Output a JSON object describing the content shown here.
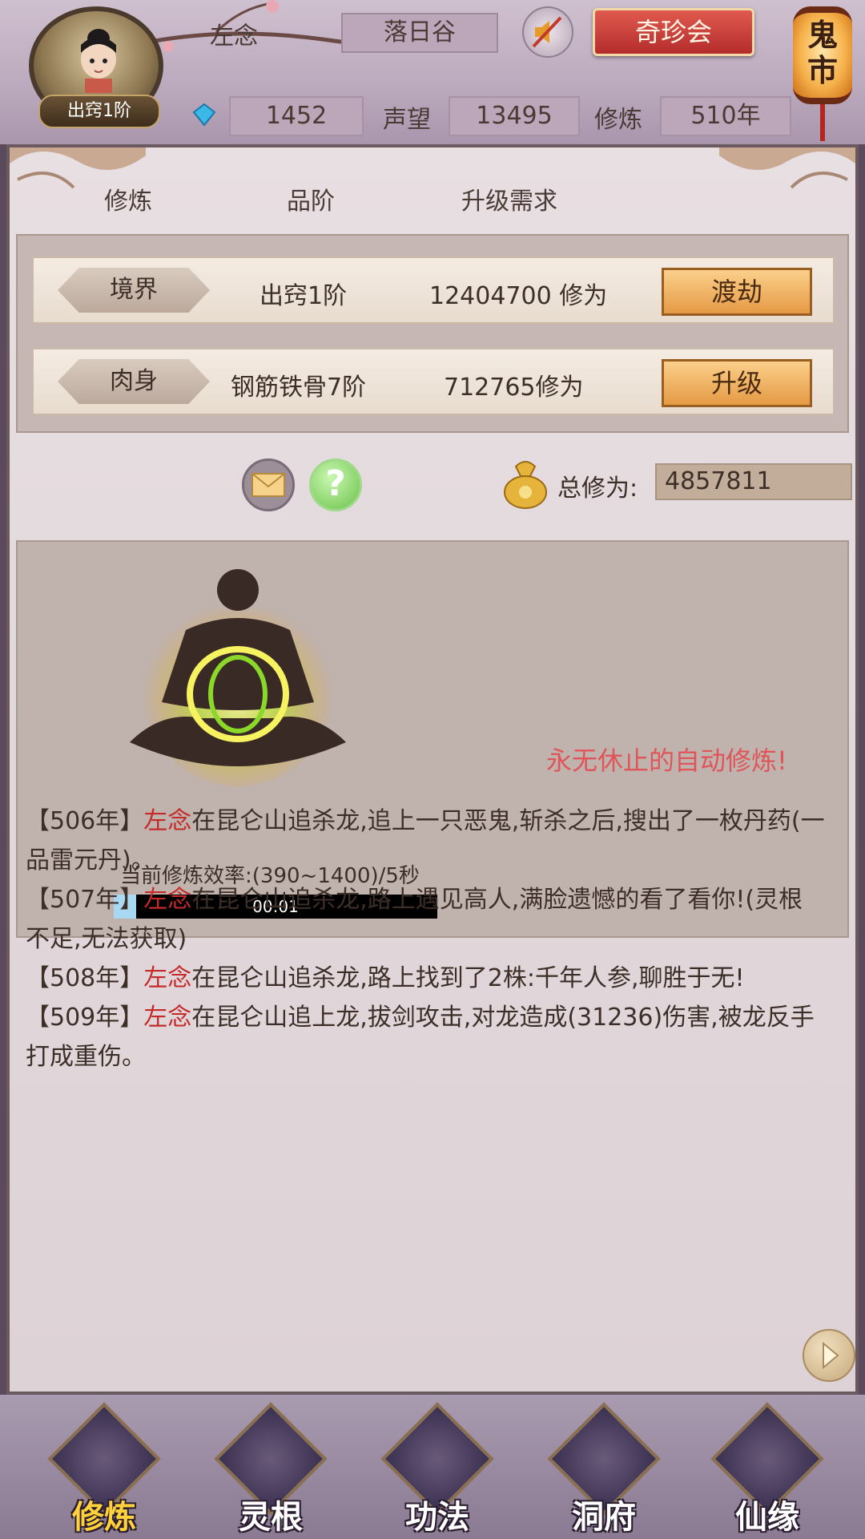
{
  "header": {
    "rank": "出窍1阶",
    "player_name": "左念",
    "location": "落日谷",
    "treasure_button": "奇珍会",
    "ghost_market": "鬼市",
    "gems": "1452",
    "prestige_label": "声望",
    "prestige": "13495",
    "cultivation_label": "修炼",
    "cultivation_years": "510年"
  },
  "table_headers": [
    "修炼",
    "品阶",
    "升级需求"
  ],
  "rows": [
    {
      "tag": "境界",
      "grade": "出窍1阶",
      "requirement": "12404700 修为",
      "button": "渡劫"
    },
    {
      "tag": "肉身",
      "grade": "钢筋铁骨7阶",
      "requirement": "712765修为",
      "button": "升级"
    }
  ],
  "total": {
    "label": "总修为:",
    "value": "4857811"
  },
  "help_symbol": "?",
  "cultivation": {
    "auto_text": "永无休止的自动修炼!",
    "rate": "当前修炼效率:(390~1400)/5秒",
    "progress_time": "00:01",
    "progress_fraction": 0.07
  },
  "log": [
    {
      "prefix": "【506年】",
      "name": "左念",
      "text": "在昆仑山追杀龙,追上一只恶鬼,斩杀之后,搜出了一枚丹药(一品雷元丹)。"
    },
    {
      "prefix": "【507年】",
      "name": "左念",
      "text": "在昆仑山追杀龙,路上遇见高人,满脸遗憾的看了看你!(灵根不足,无法获取)"
    },
    {
      "prefix": "【508年】",
      "name": "左念",
      "text": "在昆仑山追杀龙,路上找到了2株:千年人参,聊胜于无!"
    },
    {
      "prefix": "【509年】",
      "name": "左念",
      "text": "在昆仑山追上龙,拔剑攻击,对龙造成(31236)伤害,被龙反手打成重伤。"
    }
  ],
  "nav": [
    {
      "label": "修炼",
      "icon": "meditating-figure-icon",
      "active": true
    },
    {
      "label": "灵根",
      "icon": "yin-yang-sword-icon",
      "active": false
    },
    {
      "label": "功法",
      "icon": "book-icon",
      "active": false
    },
    {
      "label": "洞府",
      "icon": "pagoda-icon",
      "active": false
    },
    {
      "label": "仙缘",
      "icon": "gourd-icon",
      "active": false
    }
  ],
  "colors": {
    "accent_red": "#c42a2a",
    "auto_text": "#e0555a",
    "active_nav": "#ffd23a"
  }
}
